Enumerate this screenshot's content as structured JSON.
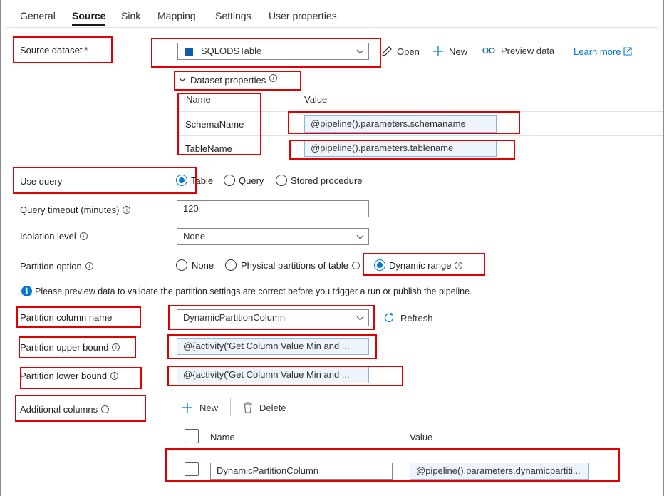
{
  "tabs": [
    "General",
    "Source",
    "Sink",
    "Mapping",
    "Settings",
    "User properties"
  ],
  "source_dataset": {
    "label": "Source dataset",
    "required_mark": "*",
    "value": "SQLODSTable",
    "open_label": "Open",
    "new_label": "New",
    "preview_label": "Preview data",
    "learn_more_label": "Learn more"
  },
  "dataset_properties": {
    "title": "Dataset properties",
    "col_name": "Name",
    "col_value": "Value",
    "rows": [
      {
        "name": "SchemaName",
        "value": "@pipeline().parameters.schemaname"
      },
      {
        "name": "TableName",
        "value": "@pipeline().parameters.tablename"
      }
    ]
  },
  "use_query": {
    "label": "Use query",
    "options": [
      "Table",
      "Query",
      "Stored procedure"
    ],
    "selected": "Table"
  },
  "query_timeout": {
    "label": "Query timeout (minutes)",
    "value": "120"
  },
  "isolation_level": {
    "label": "Isolation level",
    "value": "None"
  },
  "partition_option": {
    "label": "Partition option",
    "options": [
      "None",
      "Physical partitions of table",
      "Dynamic range"
    ],
    "selected": "Dynamic range"
  },
  "info_message": "Please preview data to validate the partition settings are correct before you trigger a run or publish the pipeline.",
  "partition_column": {
    "label": "Partition column name",
    "value": "DynamicPartitionColumn",
    "refresh_label": "Refresh"
  },
  "upper_bound": {
    "label": "Partition upper bound",
    "value": "@{activity('Get Column Value Min and ..."
  },
  "lower_bound": {
    "label": "Partition lower bound",
    "value": "@{activity('Get Column Value Min and ..."
  },
  "additional_columns": {
    "label": "Additional columns",
    "new_label": "New",
    "delete_label": "Delete",
    "col_name": "Name",
    "col_value": "Value",
    "rows": [
      {
        "name": "DynamicPartitionColumn",
        "value": "@pipeline().parameters.dynamicpartiti..."
      }
    ]
  },
  "colors": {
    "highlight_box": "#e00000",
    "accent": "#0078d4"
  }
}
